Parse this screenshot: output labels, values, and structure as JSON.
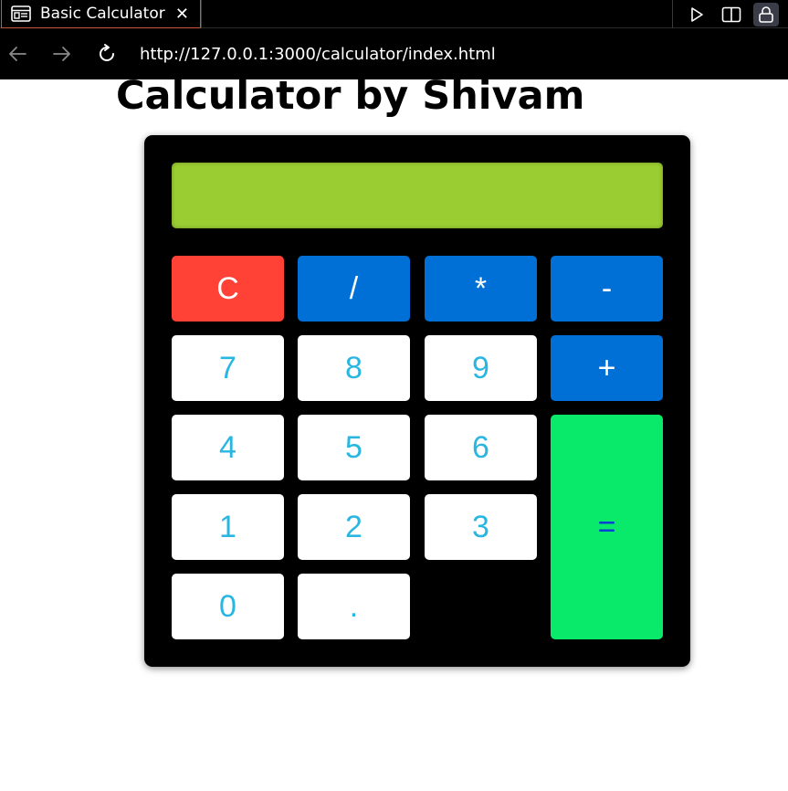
{
  "browser": {
    "tab_title": "Basic Calculator",
    "tab_close": "✕",
    "url": "http://127.0.0.1:3000/calculator/index.html"
  },
  "page": {
    "title": "Calculator by Shivam"
  },
  "calculator": {
    "display_value": "",
    "keys": {
      "clear": "C",
      "divide": "/",
      "multiply": "*",
      "subtract": "-",
      "seven": "7",
      "eight": "8",
      "nine": "9",
      "add": "+",
      "four": "4",
      "five": "5",
      "six": "6",
      "equals": "=",
      "one": "1",
      "two": "2",
      "three": "3",
      "zero": "0",
      "decimal": "."
    }
  },
  "colors": {
    "display": "#9acd32",
    "clear_key": "#ff4136",
    "operator_key": "#006fd6",
    "number_key": "#ffffff",
    "number_text": "#29b6e0",
    "equals_key": "#0aea6a",
    "equals_text": "#0b3fd6",
    "calculator_body": "#000000"
  },
  "icons": {
    "tab": "page-icon",
    "back": "arrow-left-icon",
    "forward": "arrow-right-icon",
    "reload": "reload-icon",
    "run": "play-icon",
    "split": "split-view-icon",
    "lock": "lock-icon"
  }
}
